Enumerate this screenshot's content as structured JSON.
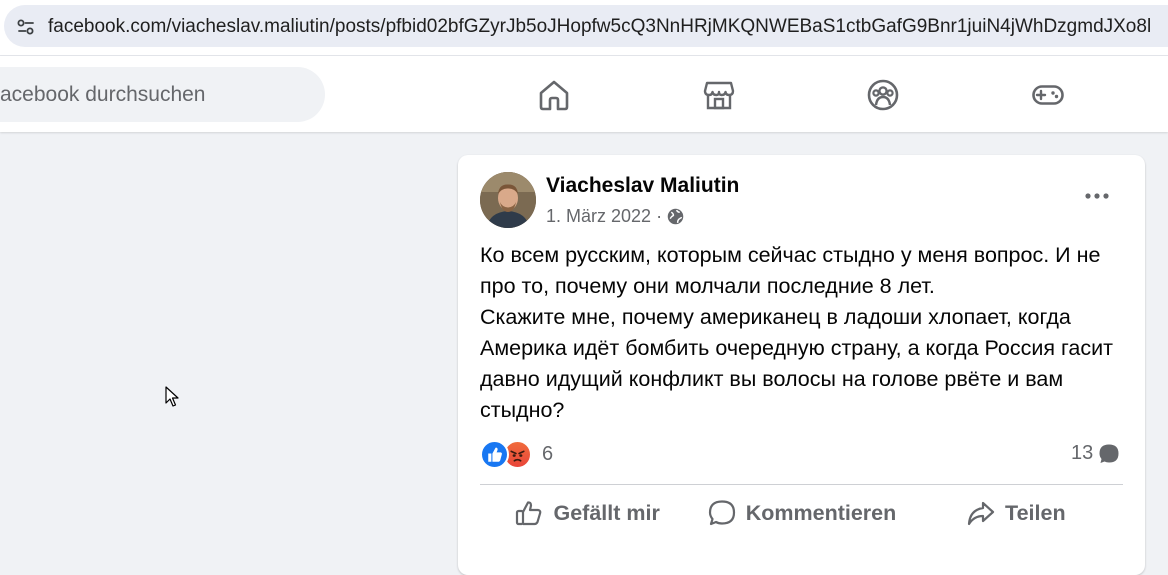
{
  "browser": {
    "url": "facebook.com/viacheslav.maliutin/posts/pfbid02bfGZyrJb5oJHopfw5cQ3NnHRjMKQNWEBaS1ctbGafG9Bnr1juiN4jWhDzgmdJXo8l",
    "site_icon": "site-settings-icon"
  },
  "header": {
    "search_placeholder": "acebook durchsuchen",
    "nav": [
      {
        "name": "home-icon"
      },
      {
        "name": "marketplace-icon"
      },
      {
        "name": "groups-icon"
      },
      {
        "name": "gaming-icon"
      }
    ]
  },
  "post": {
    "author": "Viacheslav Maliutin",
    "date": "1. März 2022",
    "separator": "·",
    "audience_icon": "globe-icon",
    "paragraphs": [
      "Ко всем русским, которым сейчас стыдно у меня вопрос. И не про то, почему они молчали последние 8 лет.",
      "Скажите мне, почему американец в ладоши хлопает, когда Америка идёт бомбить очередную страну, а когда Россия гасит давно идущий конфликт вы волосы на голове рвёте и вам стыдно?"
    ],
    "reactions": {
      "types": [
        "like",
        "angry"
      ],
      "count": "6"
    },
    "comments_count": "13",
    "actions": {
      "like": "Gefällt mir",
      "comment": "Kommentieren",
      "share": "Teilen"
    }
  },
  "colors": {
    "accent": "#1877f2",
    "secondary_text": "#65676b",
    "background": "#f0f2f5"
  }
}
